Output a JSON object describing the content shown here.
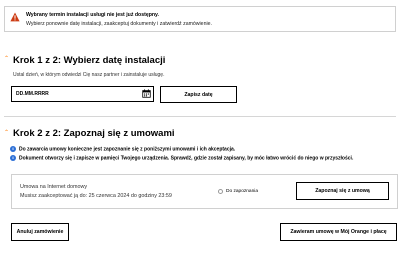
{
  "alert": {
    "title": "Wybrany termin instalacji usługi nie jest już dostępny.",
    "message": "Wybierz ponownie datę instalacji, zaakceptuj dokumenty i zatwierdź zamówienie.",
    "icon": "warning-icon",
    "color": "#cd3c14"
  },
  "step1": {
    "title": "Krok 1 z 2: Wybierz datę instalacji",
    "hint": "Ustal dzień, w którym odwiedzi Cię nasz partner i zainstaluje usługę.",
    "date_placeholder": "DD.MM.RRRR",
    "save_label": "Zapisz datę"
  },
  "step2": {
    "title": "Krok 2 z 2: Zapoznaj się z umowami",
    "info1": "Do zawarcia umowy konieczne jest zapoznanie się z poniższymi umowami i ich akceptacja.",
    "info2": "Dokument otworzy się i zapisze w pamięci Twojego urządzenia. Sprawdź, gdzie został zapisany, by móc łatwo wrócić do niego w przyszłości.",
    "contract": {
      "name": "Umowa na Internet domowy",
      "deadline": "Musisz zaakceptować ją do: 25 czerwca 2024 do godziny 23:59",
      "status": "Do zapoznania",
      "read_label": "Zapoznaj się z umową"
    }
  },
  "footer": {
    "cancel_label": "Anuluj zamówienie",
    "confirm_label": "Zawieram umowę w Mój Orange i płacę"
  },
  "colors": {
    "accent": "#ff7900",
    "info": "#2c6fd6",
    "warning": "#cd3c14"
  }
}
